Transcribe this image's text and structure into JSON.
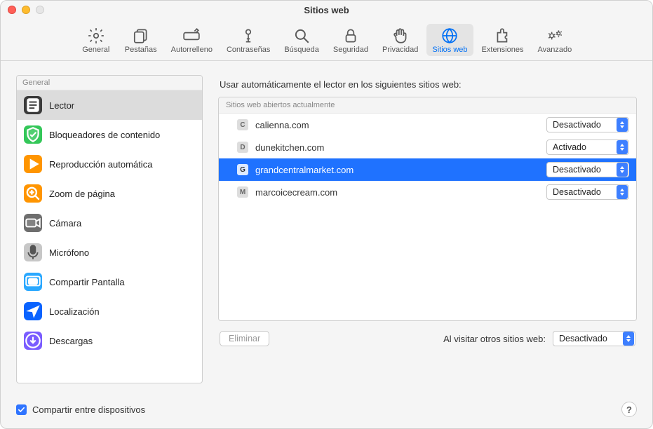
{
  "window_title": "Sitios web",
  "toolbar": {
    "items": [
      {
        "label": "General",
        "icon": "gear-icon"
      },
      {
        "label": "Pestañas",
        "icon": "tabs-icon"
      },
      {
        "label": "Autorrelleno",
        "icon": "pencil-icon"
      },
      {
        "label": "Contraseñas",
        "icon": "key-icon"
      },
      {
        "label": "Búsqueda",
        "icon": "search-icon"
      },
      {
        "label": "Seguridad",
        "icon": "lock-icon"
      },
      {
        "label": "Privacidad",
        "icon": "hand-icon"
      },
      {
        "label": "Sitios web",
        "icon": "globe-icon",
        "selected": true
      },
      {
        "label": "Extensiones",
        "icon": "puzzle-icon"
      },
      {
        "label": "Avanzado",
        "icon": "gears-icon"
      }
    ]
  },
  "sidebar": {
    "header": "General",
    "items": [
      {
        "label": "Lector",
        "icon": "reader-icon",
        "bg": "#3a3a3a",
        "selected": true
      },
      {
        "label": "Bloqueadores de contenido",
        "icon": "shield-icon",
        "bg": "#34c759"
      },
      {
        "label": "Reproducción automática",
        "icon": "play-icon",
        "bg": "#ff9500"
      },
      {
        "label": "Zoom de página",
        "icon": "zoom-icon",
        "bg": "#ff9500"
      },
      {
        "label": "Cámara",
        "icon": "camera-icon",
        "bg": "#6e6e6e"
      },
      {
        "label": "Micrófono",
        "icon": "mic-icon",
        "bg": "#c7c7c7"
      },
      {
        "label": "Compartir Pantalla",
        "icon": "screen-share-icon",
        "bg": "#2aa8ff"
      },
      {
        "label": "Localización",
        "icon": "location-icon",
        "bg": "#0a63ff"
      },
      {
        "label": "Descargas",
        "icon": "download-icon",
        "bg": "#7a5cff"
      }
    ]
  },
  "main": {
    "title": "Usar automáticamente el lector en los siguientes sitios web:",
    "list_header": "Sitios web abiertos actualmente",
    "sites": [
      {
        "name": "calienna.com",
        "value": "Desactivado",
        "selected": false
      },
      {
        "name": "dunekitchen.com",
        "value": "Activado",
        "selected": false
      },
      {
        "name": "grandcentralmarket.com",
        "value": "Desactivado",
        "selected": true
      },
      {
        "name": "marcoicecream.com",
        "value": "Desactivado",
        "selected": false
      }
    ],
    "remove_button": "Eliminar",
    "other_sites_label": "Al visitar otros sitios web:",
    "other_sites_value": "Desactivado"
  },
  "bottom": {
    "share_label": "Compartir entre dispositivos",
    "help": "?"
  }
}
